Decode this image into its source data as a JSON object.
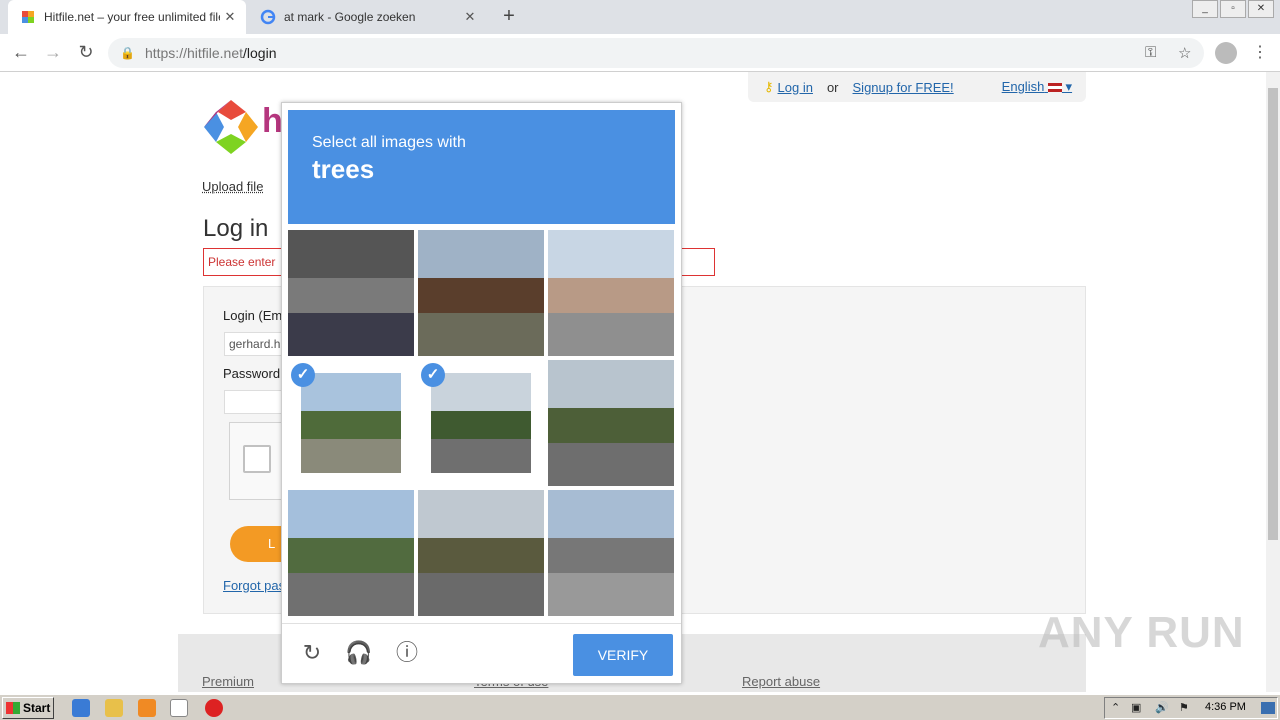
{
  "browser": {
    "tabs": [
      {
        "title": "Hitfile.net – your free unlimited file s",
        "close": "✕"
      },
      {
        "title": "at mark - Google zoeken",
        "close": "✕"
      }
    ],
    "newtab": "+",
    "url_host": "https://hitfile.net",
    "url_path": "/login"
  },
  "site": {
    "top_login": "Log in",
    "top_or": "or",
    "top_signup": "Signup for FREE!",
    "language": "English",
    "logo_letter": "h",
    "upload_link": "Upload file",
    "heading": "Log in",
    "error_text": "Please enter",
    "login_label": "Login (Em",
    "login_value": "gerhard.h",
    "password_label": "Password",
    "login_button": "L",
    "forgot_link": "Forgot pas",
    "footer_premium": "Premium",
    "footer_terms": "Terms of use",
    "footer_report": "Report abuse"
  },
  "captcha": {
    "instruction": "Select all images with",
    "keyword": "trees",
    "verify_label": "VERIFY",
    "tiles": [
      {
        "scene": "graffiti-wall-road",
        "selected": false,
        "colors": [
          "#555555",
          "#7a7a7a",
          "#3b3b4a"
        ]
      },
      {
        "scene": "brick-building",
        "selected": false,
        "colors": [
          "#9fb2c6",
          "#5a3e2c",
          "#6b6b5a"
        ]
      },
      {
        "scene": "gravel-construction",
        "selected": false,
        "colors": [
          "#c8d6e4",
          "#b89a86",
          "#8f8f8f"
        ]
      },
      {
        "scene": "tree-sky",
        "selected": true,
        "colors": [
          "#a9c3dd",
          "#4f6b3a",
          "#8a8a7a"
        ]
      },
      {
        "scene": "palm-trees-road",
        "selected": true,
        "colors": [
          "#c9d3dc",
          "#3f5a30",
          "#6f6f6f"
        ]
      },
      {
        "scene": "roadside-trees",
        "selected": false,
        "colors": [
          "#b8c4ce",
          "#4d5f38",
          "#6e6e6e"
        ]
      },
      {
        "scene": "highway-sky",
        "selected": false,
        "colors": [
          "#a4bfdc",
          "#516b3f",
          "#707070"
        ]
      },
      {
        "scene": "street-trees",
        "selected": false,
        "colors": [
          "#bfc8d0",
          "#5a5a3e",
          "#6a6a6a"
        ]
      },
      {
        "scene": "traffic-light-intersection",
        "selected": false,
        "colors": [
          "#a7bcd3",
          "#777777",
          "#999999"
        ]
      }
    ],
    "check_glyph": "✓"
  },
  "watermark": "ANY RUN",
  "taskbar": {
    "start_label": "Start",
    "clock": "4:36 PM"
  }
}
